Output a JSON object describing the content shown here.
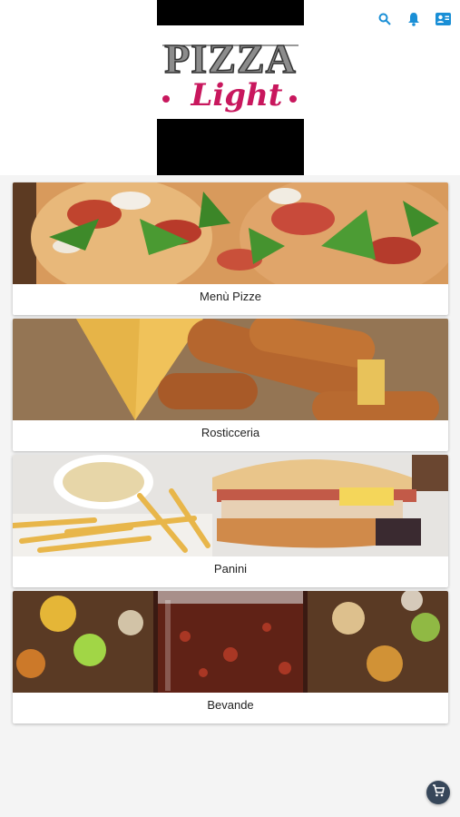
{
  "brand": {
    "logo_line1": "PIZZA",
    "logo_line2": "Light"
  },
  "header": {
    "icons": [
      "search-icon",
      "bell-icon",
      "contact-card-icon"
    ],
    "accent_color": "#1a8fd6"
  },
  "categories": [
    {
      "label": "Menù Pizze"
    },
    {
      "label": "Rosticceria"
    },
    {
      "label": "Panini"
    },
    {
      "label": "Bevande"
    }
  ],
  "fab": {
    "icon": "cart-icon",
    "color": "#37475a"
  }
}
